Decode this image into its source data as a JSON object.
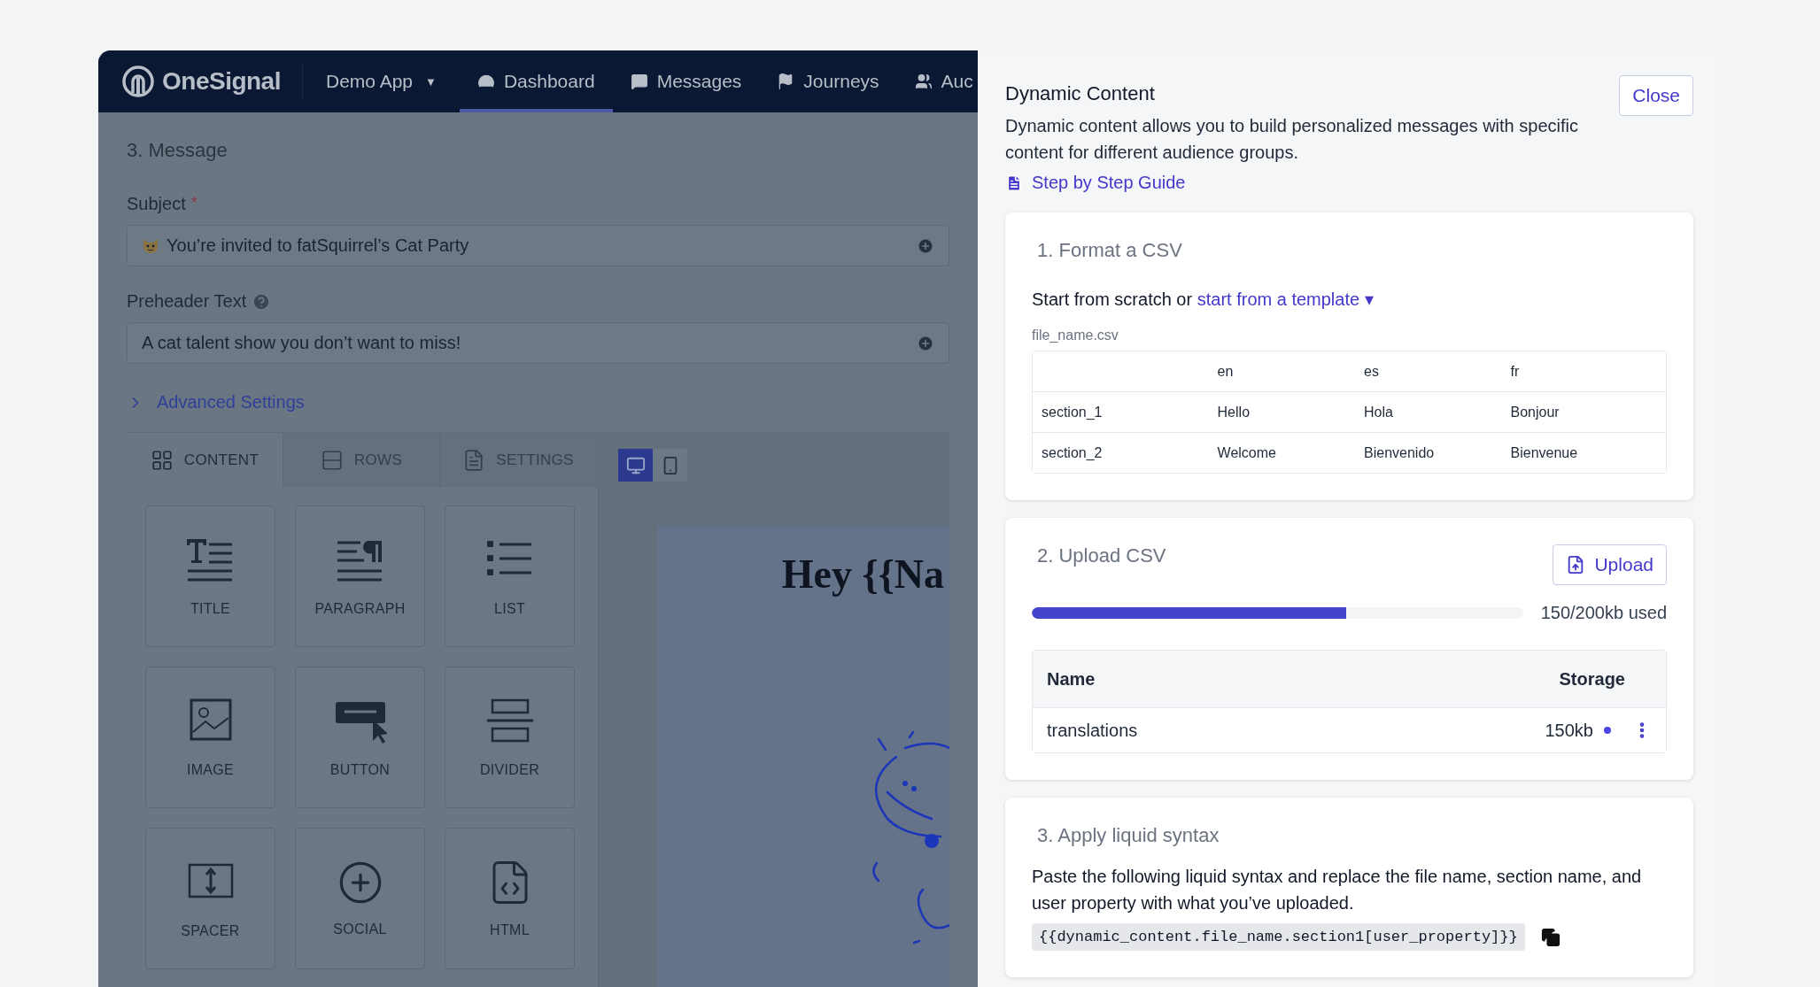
{
  "nav": {
    "brand": "OneSignal",
    "app": "Demo App",
    "app_caret": "▼",
    "items": [
      {
        "kind": "dashboard",
        "label": "Dashboard",
        "selected": true
      },
      {
        "kind": "messages",
        "label": "Messages",
        "selected": false
      },
      {
        "kind": "journeys",
        "label": "Journeys",
        "selected": false
      },
      {
        "kind": "audience",
        "label": "Auc",
        "selected": false
      }
    ]
  },
  "message": {
    "heading": "3. Message",
    "subject": {
      "label": "Subject",
      "required_mark": "*",
      "value": "You’re invited to fatSquirrel’s Cat Party"
    },
    "preheader": {
      "label": "Preheader Text",
      "value": "A cat talent show you don’t want to miss!"
    },
    "advanced": {
      "label": "Advanced Settings",
      "expanded": false
    }
  },
  "editor_tabs": [
    {
      "kind": "content",
      "label": "CONTENT",
      "selected": true
    },
    {
      "kind": "rows",
      "label": "ROWS",
      "selected": false
    },
    {
      "kind": "settings",
      "label": "SETTINGS",
      "selected": false
    }
  ],
  "devices": [
    {
      "kind": "desktop",
      "selected": true
    },
    {
      "kind": "mobile",
      "selected": false
    }
  ],
  "tiles": [
    {
      "kind": "title",
      "label": "TITLE"
    },
    {
      "kind": "paragraph",
      "label": "PARAGRAPH"
    },
    {
      "kind": "list",
      "label": "LIST"
    },
    {
      "kind": "image",
      "label": "IMAGE"
    },
    {
      "kind": "button",
      "label": "BUTTON"
    },
    {
      "kind": "divider",
      "label": "DIVIDER"
    },
    {
      "kind": "spacer",
      "label": "SPACER"
    },
    {
      "kind": "social",
      "label": "SOCIAL"
    },
    {
      "kind": "html",
      "label": "HTML"
    }
  ],
  "preview": {
    "heading": "Hey {{Na"
  },
  "drawer": {
    "title": "Dynamic Content",
    "description": "Dynamic content allows you to build personalized messages with specific content for different audience groups.",
    "guide": "Step by Step Guide",
    "close": "Close",
    "format": {
      "title": "1. Format a CSV",
      "intro": "Start from scratch or",
      "link": "start from a template",
      "link_caret": "▾",
      "file_name": "file_name.csv",
      "columns": [
        "en",
        "es",
        "fr"
      ],
      "rows": [
        {
          "section": "section_1",
          "values": [
            "Hello",
            "Hola",
            "Bonjour"
          ]
        },
        {
          "section": "section_2",
          "values": [
            "Welcome",
            "Bienvenido",
            "Bienvenue"
          ]
        }
      ]
    },
    "upload": {
      "title": "2. Upload CSV",
      "button": "Upload",
      "level": 0.64,
      "usage": "150/200kb used",
      "columns": [
        "Name",
        "Storage"
      ],
      "rows": [
        {
          "name": "translations",
          "storage": "150kb",
          "color": "#4f46e5"
        }
      ]
    },
    "liquid": {
      "title": "3. Apply liquid syntax",
      "text": "Paste the following liquid syntax and replace the file name, section name, and user property with what you’ve uploaded.",
      "code": "{{dynamic_content.file_name.section1[user_property]}}"
    }
  }
}
